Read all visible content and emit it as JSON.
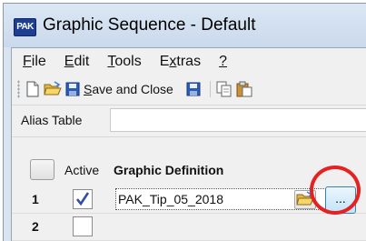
{
  "window": {
    "title": "Graphic Sequence - Default",
    "app_icon_text": "PAK"
  },
  "menu": {
    "items": [
      {
        "label": "File",
        "mnemonic": "F",
        "rest": "ile"
      },
      {
        "label": "Edit",
        "mnemonic": "E",
        "rest": "dit"
      },
      {
        "label": "Tools",
        "mnemonic": "T",
        "rest": "ools"
      },
      {
        "label": "Extras",
        "mnemonic": "x",
        "prefix": "E",
        "rest": "tras"
      },
      {
        "label": "?",
        "mnemonic": "?",
        "rest": ""
      }
    ]
  },
  "toolbar": {
    "new_icon": "new-document-icon",
    "open_icon": "open-folder-icon",
    "save_close_label": "Save and Close",
    "save_close_mnemonic": "S",
    "save_close_rest": "ave and Close",
    "save_icon": "save-icon",
    "copy_icon": "copy-icon",
    "paste_icon": "paste-icon"
  },
  "alias": {
    "label": "Alias Table",
    "value": ""
  },
  "grid": {
    "columns": {
      "active": "Active",
      "definition": "Graphic Definition"
    },
    "rows": [
      {
        "num": "1",
        "active": true,
        "definition": "PAK_Tip_05_2018"
      },
      {
        "num": "2",
        "active": false,
        "definition": ""
      }
    ],
    "browse_button_label": "..."
  },
  "colors": {
    "highlight_ring": "#e52222",
    "title_bar": "#d9e4f1",
    "check_mark": "#2f4ea8"
  }
}
